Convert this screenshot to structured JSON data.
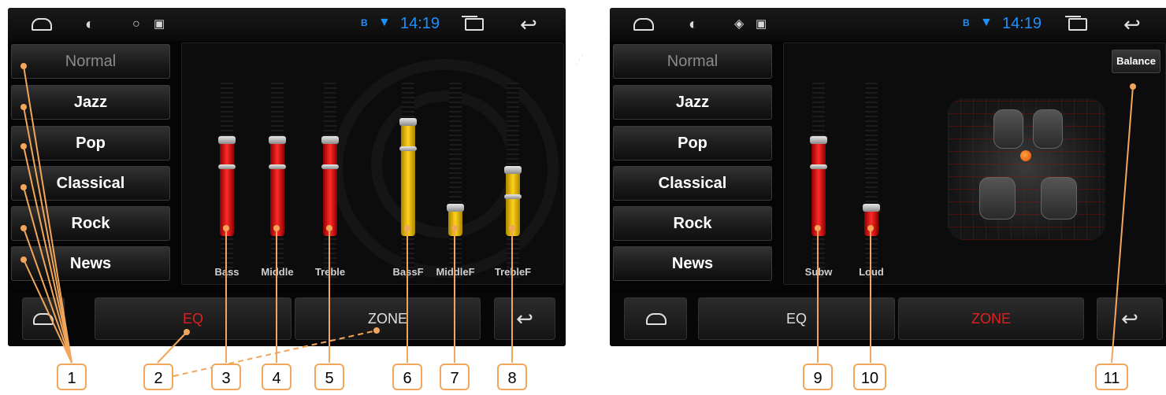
{
  "status_bar": {
    "time": "14:19",
    "bt": "B"
  },
  "presets": [
    "Normal",
    "Jazz",
    "Pop",
    "Classical",
    "Rock",
    "News"
  ],
  "left_screen": {
    "sliders": [
      {
        "label": "Bass",
        "level": 0.5,
        "color": "red"
      },
      {
        "label": "Middle",
        "level": 0.5,
        "color": "red"
      },
      {
        "label": "Treble",
        "level": 0.5,
        "color": "red"
      },
      {
        "label": "BassF",
        "level": 0.62,
        "color": "yellow"
      },
      {
        "label": "MiddleF",
        "level": 0.05,
        "color": "yellow"
      },
      {
        "label": "TrebleF",
        "level": 0.3,
        "color": "yellow"
      }
    ],
    "tabs": {
      "eq": "EQ",
      "zone": "ZONE"
    },
    "active_tab": "eq"
  },
  "right_screen": {
    "sliders": [
      {
        "label": "Subw",
        "level": 0.5,
        "color": "red"
      },
      {
        "label": "Loud",
        "level": 0.05,
        "color": "red"
      }
    ],
    "balance_label": "Balance",
    "tabs": {
      "eq": "EQ",
      "zone": "ZONE"
    },
    "active_tab": "zone"
  },
  "callouts": [
    "1",
    "2",
    "3",
    "4",
    "5",
    "6",
    "7",
    "8",
    "9",
    "10",
    "11"
  ],
  "colors": {
    "accent_red": "#e02020",
    "status_blue": "#1e90ff",
    "callout_orange": "#f2a65a",
    "slider_red": "#ff2a2a",
    "slider_yellow": "#ffd11a"
  },
  "icons": [
    "home-icon",
    "brightness-icon",
    "gps-icon",
    "picture-icon",
    "bluetooth-icon",
    "wifi-icon",
    "recent-apps-icon",
    "back-icon"
  ]
}
